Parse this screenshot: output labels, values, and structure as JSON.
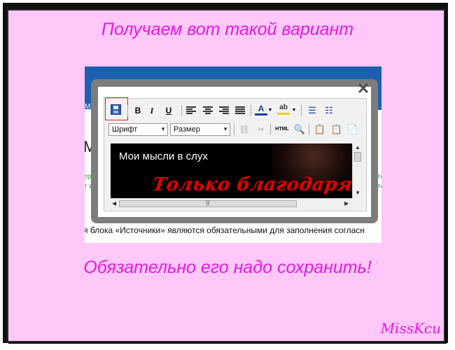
{
  "captions": {
    "top": "Получаем вот такой вариант",
    "bottom": "Обязательно его надо сохранить!",
    "signature": "MissKcu"
  },
  "screenshot": {
    "nav_fragment": "Мага",
    "heading_fragment": "М",
    "green_left_1": "тер",
    "green_left_2": "ст в",
    "green_right_1": "те",
    "green_right_2": "те",
    "note_text": "я блока «Источники» являются обязательными для заполнения согласн"
  },
  "modal": {
    "close_glyph": "✕"
  },
  "editor": {
    "toolbar": {
      "bold": "B",
      "italic": "I",
      "underline": "U",
      "font_color": "A",
      "highlight": "ab",
      "html": "HTML"
    },
    "font_select": "Шрифт",
    "size_select": "Размер",
    "content_title": "Мои мысли в слух",
    "content_red": "Только благодаря в"
  },
  "colors": {
    "caption": "#e41ae4",
    "page_bg": "#ffc8f8",
    "highlight_border": "#e02020",
    "header_blue": "#1f5fb0"
  }
}
